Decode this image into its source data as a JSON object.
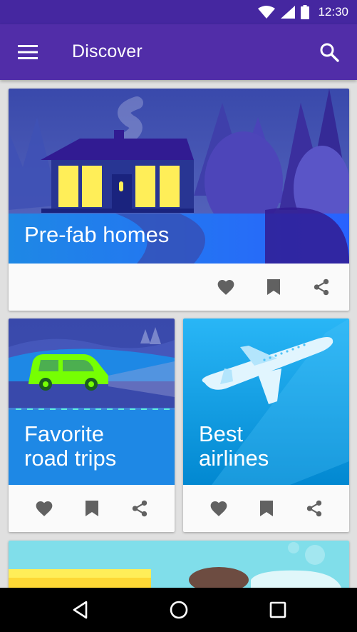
{
  "status_bar": {
    "time": "12:30",
    "icons": [
      "wifi-icon",
      "cell-signal-icon",
      "battery-icon"
    ]
  },
  "app_bar": {
    "title": "Discover",
    "menu_icon": "menu-icon",
    "search_icon": "search-icon"
  },
  "cards": [
    {
      "title": "Pre-fab homes",
      "actions": [
        "heart-icon",
        "bookmark-icon",
        "share-icon"
      ]
    },
    {
      "title": "Favorite\nroad trips",
      "actions": [
        "heart-icon",
        "bookmark-icon",
        "share-icon"
      ]
    },
    {
      "title": "Best\nairlines",
      "actions": [
        "heart-icon",
        "bookmark-icon",
        "share-icon"
      ]
    }
  ],
  "nav_bar": {
    "buttons": [
      "back-icon",
      "home-icon",
      "recents-icon"
    ]
  },
  "colors": {
    "status_bar": "#4527a0",
    "app_bar": "#512da8",
    "action_icon": "#616161",
    "background": "#e0e0e0"
  }
}
